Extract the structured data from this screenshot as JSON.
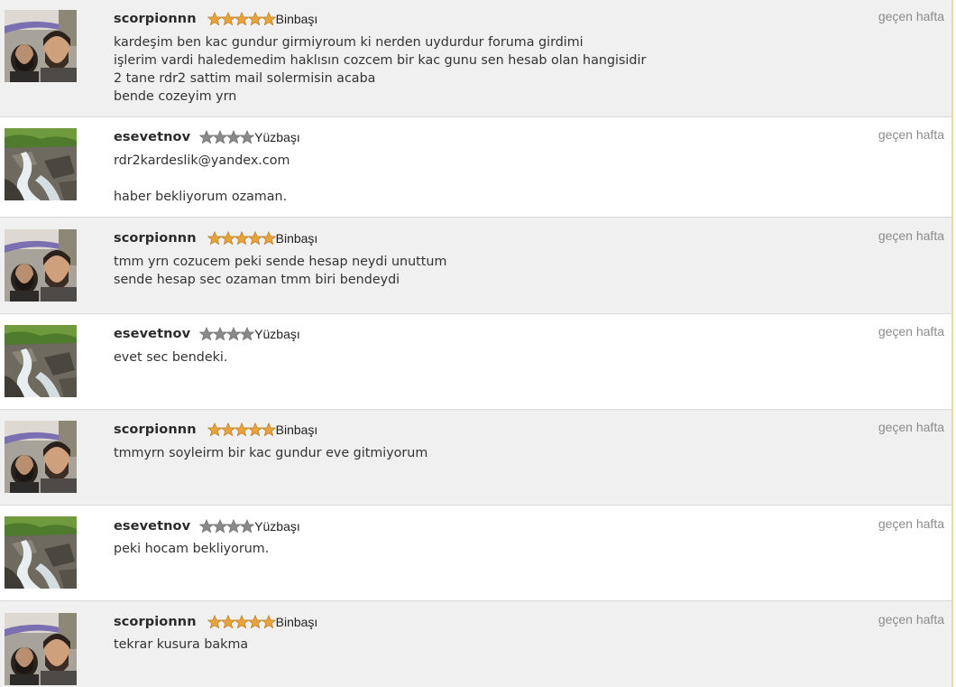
{
  "posts": [
    {
      "username": "scorpionnn",
      "stars": 5,
      "rank": "Binbaşı",
      "date": "geçen hafta",
      "avatar": "man-avatar",
      "lines": [
        "kardeşim ben kac gundur girmiyroum ki nerden uydurdur foruma girdimi",
        "işlerim vardi haledemedim haklısın cozcem bir kac gunu sen hesab olan hangisidir",
        "2 tane rdr2 sattim mail solermisin acaba",
        "bende cozeyim yrn"
      ]
    },
    {
      "username": "esevetnov",
      "stars": 4,
      "rank": "Yüzbaşı",
      "date": "geçen hafta",
      "avatar": "waterfall-avatar",
      "lines": [
        "rdr2kardeslik@yandex.com",
        "",
        "haber bekliyorum ozaman."
      ]
    },
    {
      "username": "scorpionnn",
      "stars": 5,
      "rank": "Binbaşı",
      "date": "geçen hafta",
      "avatar": "man-avatar",
      "lines": [
        "tmm yrn cozucem peki sende hesap neydi unuttum",
        "sende hesap sec ozaman tmm biri bendeydi"
      ]
    },
    {
      "username": "esevetnov",
      "stars": 4,
      "rank": "Yüzbaşı",
      "date": "geçen hafta",
      "avatar": "waterfall-avatar",
      "lines": [
        "evet sec bendeki."
      ]
    },
    {
      "username": "scorpionnn",
      "stars": 5,
      "rank": "Binbaşı",
      "date": "geçen hafta",
      "avatar": "man-avatar",
      "lines": [
        "tmmyrn soyleirm bir kac gundur eve gitmiyorum"
      ]
    },
    {
      "username": "esevetnov",
      "stars": 4,
      "rank": "Yüzbaşı",
      "date": "geçen hafta",
      "avatar": "waterfall-avatar",
      "lines": [
        "peki hocam bekliyorum."
      ]
    },
    {
      "username": "scorpionnn",
      "stars": 5,
      "rank": "Binbaşı",
      "date": "geçen hafta",
      "avatar": "man-avatar",
      "lines": [
        "tekrar kusura bakma"
      ]
    }
  ],
  "colors": {
    "gold_star": "#e8a33a",
    "gray_star": "#8a8a8a",
    "gray_row": "#f0f0f0",
    "white_row": "#ffffff",
    "date_text": "#8c8c8c",
    "divider": "#d9d9d9"
  }
}
